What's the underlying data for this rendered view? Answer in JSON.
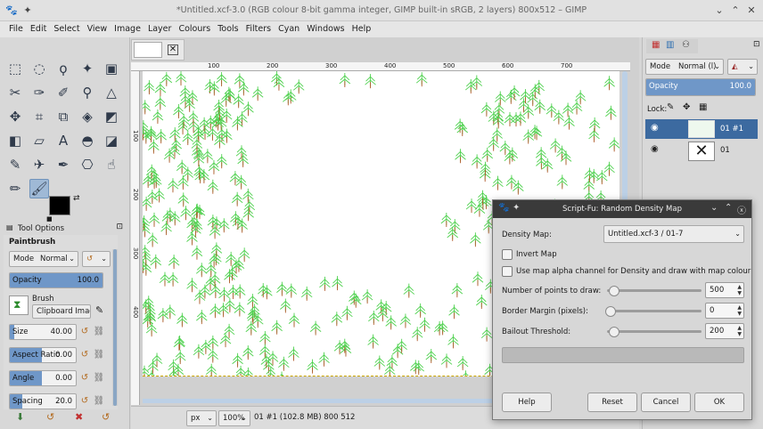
{
  "window": {
    "title": "*Untitled.xcf-3.0 (RGB colour 8-bit gamma integer, GIMP built-in sRGB, 2 layers) 800x512 – GIMP"
  },
  "menu": [
    "File",
    "Edit",
    "Select",
    "View",
    "Image",
    "Layer",
    "Colours",
    "Tools",
    "Filters",
    "Cyan",
    "Windows",
    "Help"
  ],
  "tool_icons": [
    "rect-select-icon",
    "ellipse-select-icon",
    "free-select-icon",
    "fuzzy-select-icon",
    "foreground-select-icon",
    "scissors-icon",
    "paths-icon",
    "color-picker-icon",
    "zoom-icon",
    "measure-icon",
    "move-icon",
    "crop-icon",
    "unified-transform-icon",
    "warp-icon",
    "handle-transform-icon",
    "flip-icon",
    "perspective-icon",
    "text-icon",
    "bucket-fill-icon",
    "gradient-icon",
    "paintbrush-icon",
    "airbrush-icon",
    "ink-icon",
    "clone-icon",
    "smudge-icon",
    "pencil-icon",
    "mypaint-icon"
  ],
  "tool_options": {
    "tab_label": "Tool Options",
    "tool_name": "Paintbrush",
    "mode_label": "Mode",
    "mode_value": "Normal",
    "opacity_label": "Opacity",
    "opacity_value": "100.0",
    "opacity_level": 1.0,
    "brush_label": "Brush",
    "brush_value": "Clipboard Image",
    "size_label": "Size",
    "size_value": "40.00",
    "aspect_label": "Aspect Ratio",
    "aspect_value": "0.00",
    "angle_label": "Angle",
    "angle_value": "0.00",
    "spacing_label": "Spacing",
    "spacing_value": "20.0"
  },
  "ruler": {
    "h": [
      "100",
      "200",
      "300",
      "400",
      "500",
      "600",
      "700"
    ],
    "v": [
      "100",
      "200",
      "300",
      "400"
    ]
  },
  "status": {
    "unit": "px",
    "zoom": "100%",
    "info": "01 #1 (102.8 MB) 800 512"
  },
  "layers": {
    "mode_label": "Mode",
    "mode_value": "Normal (l)",
    "opacity_label": "Opacity",
    "opacity_value": "100.0",
    "lock_label": "Lock:",
    "rows": [
      {
        "name": "01 #1"
      },
      {
        "name": "01"
      }
    ]
  },
  "dialog": {
    "title": "Script-Fu: Random Density Map",
    "density_label": "Density Map:",
    "density_value": "Untitled.xcf-3 / 01-7",
    "invert_label": "Invert Map",
    "alpha_label": "Use map alpha channel for Density and draw with map colour",
    "points_label": "Number of points to draw:",
    "points_value": "500",
    "points_level": 0.04,
    "border_label": "Border Margin (pixels):",
    "border_value": "0",
    "border_level": 0.0,
    "bailout_label": "Bailout Threshold:",
    "bailout_value": "200",
    "bailout_level": 0.04,
    "help": "Help",
    "reset": "Reset",
    "cancel": "Cancel",
    "ok": "OK"
  }
}
